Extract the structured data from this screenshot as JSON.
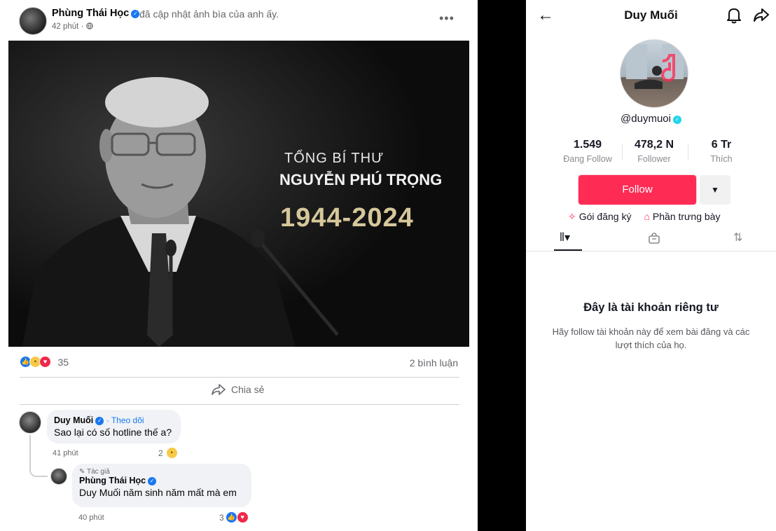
{
  "facebook": {
    "post": {
      "author": "Phùng Thái Học",
      "action": "đã cập nhật ảnh bìa của anh ấy.",
      "time": "42 phút ·",
      "image": {
        "line1": "TỔNG BÍ THƯ",
        "line2": "NGUYỄN PHÚ TRỌNG",
        "years": "1944-2024"
      },
      "reaction_count": "35",
      "comment_count": "2 bình luận",
      "share_label": "Chia sẻ"
    },
    "comments": [
      {
        "name": "Duy Muối",
        "follow": "· Theo dõi",
        "text": "Sao lại có số hotline thế a?",
        "time": "41 phút",
        "reactions": "2"
      },
      {
        "badge": "Tác giả",
        "name": "Phùng Thái Học",
        "text": "Duy Muối năm sinh năm mất mà em",
        "time": "40 phút",
        "reactions": "3"
      }
    ]
  },
  "tiktok": {
    "title": "Duy Muối",
    "handle": "@duymuoi",
    "stats": [
      {
        "num": "1.549",
        "label": "Đang Follow"
      },
      {
        "num": "478,2 N",
        "label": "Follower"
      },
      {
        "num": "6 Tr",
        "label": "Thích"
      }
    ],
    "follow_label": "Follow",
    "links": [
      "Gói đăng ký",
      "Phần trưng bày"
    ],
    "private_title": "Đây là tài khoản riêng tư",
    "private_sub": "Hãy follow tài khoản này để xem bài đăng và các lượt thích của họ."
  },
  "colors": {
    "facebook_blue": "#1877f2",
    "tiktok_red": "#fe2c55",
    "year_gold": "#d6c79a"
  }
}
